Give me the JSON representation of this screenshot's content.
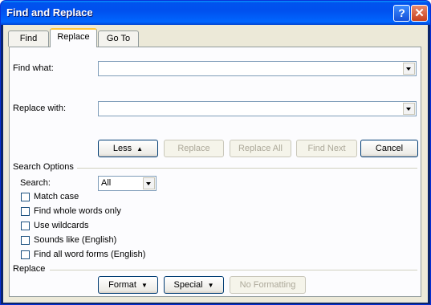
{
  "window": {
    "title": "Find and Replace"
  },
  "titlebar": {
    "help_glyph": "?",
    "close_glyph": "✕"
  },
  "tabs": [
    {
      "label": "Find"
    },
    {
      "label": "Replace",
      "active": true
    },
    {
      "label": "Go To"
    }
  ],
  "find": {
    "label": "Find what:",
    "value": ""
  },
  "replace": {
    "label": "Replace with:",
    "value": ""
  },
  "buttons": {
    "less": "Less",
    "less_icon": "▲",
    "replace": "Replace",
    "replace_all": "Replace All",
    "find_next": "Find Next",
    "cancel": "Cancel"
  },
  "search_options": {
    "title": "Search Options",
    "search_label": "Search:",
    "search_value": "All",
    "checkboxes": [
      {
        "label": "Match case",
        "checked": false
      },
      {
        "label": "Find whole words only",
        "checked": false
      },
      {
        "label": "Use wildcards",
        "checked": false
      },
      {
        "label": "Sounds like (English)",
        "checked": false
      },
      {
        "label": "Find all word forms (English)",
        "checked": false
      }
    ]
  },
  "replace_section": {
    "title": "Replace",
    "format": "Format",
    "special": "Special",
    "no_formatting": "No Formatting",
    "dropdown_icon": "▼"
  }
}
